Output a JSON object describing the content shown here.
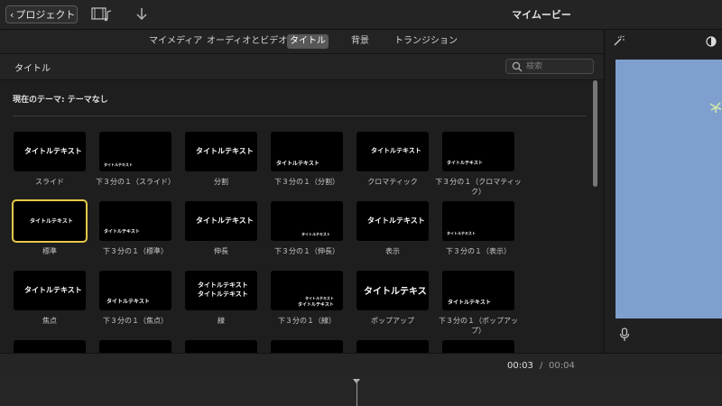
{
  "toolbar": {
    "back_label": "プロジェクト",
    "title": "マイムービー",
    "media_icon": "film-music-icon",
    "import_icon": "download-arrow-icon"
  },
  "browser": {
    "tabs": [
      {
        "label": "マイメディア",
        "active": false
      },
      {
        "label": "オーディオとビデオ",
        "active": false
      },
      {
        "label": "タイトル",
        "active": true
      },
      {
        "label": "背景",
        "active": false
      },
      {
        "label": "トランジション",
        "active": false
      }
    ],
    "section_title": "タイトル",
    "search_placeholder": "検索",
    "theme_label": "現在のテーマ: テーマなし",
    "sample_text": "タイトルテキスト",
    "titles": [
      {
        "name": "スライド"
      },
      {
        "name": "下３分の１（スライド）"
      },
      {
        "name": "分割"
      },
      {
        "name": "下３分の１（分割）"
      },
      {
        "name": "クロマティック"
      },
      {
        "name": "下３分の１（クロマティック）"
      },
      {
        "name": "標準",
        "selected": true
      },
      {
        "name": "下３分の１（標準）"
      },
      {
        "name": "伸長"
      },
      {
        "name": "下３分の１（伸長）"
      },
      {
        "name": "表示"
      },
      {
        "name": "下３分の１（表示）"
      },
      {
        "name": "焦点"
      },
      {
        "name": "下３分の１（焦点）"
      },
      {
        "name": "線"
      },
      {
        "name": "下３分の１（線）"
      },
      {
        "name": "ポップアップ"
      },
      {
        "name": "下３分の１（ポップアップ）"
      }
    ]
  },
  "viewer": {
    "wand_icon": "magic-wand-icon",
    "color_icon": "color-correction-icon",
    "mic_icon": "microphone-icon"
  },
  "timeline": {
    "current_time": "00:03",
    "separator": "/",
    "total_time": "00:04"
  },
  "colors": {
    "selection": "#e8c84a",
    "sky": "#7f9fce",
    "active_tab": "#585858"
  }
}
